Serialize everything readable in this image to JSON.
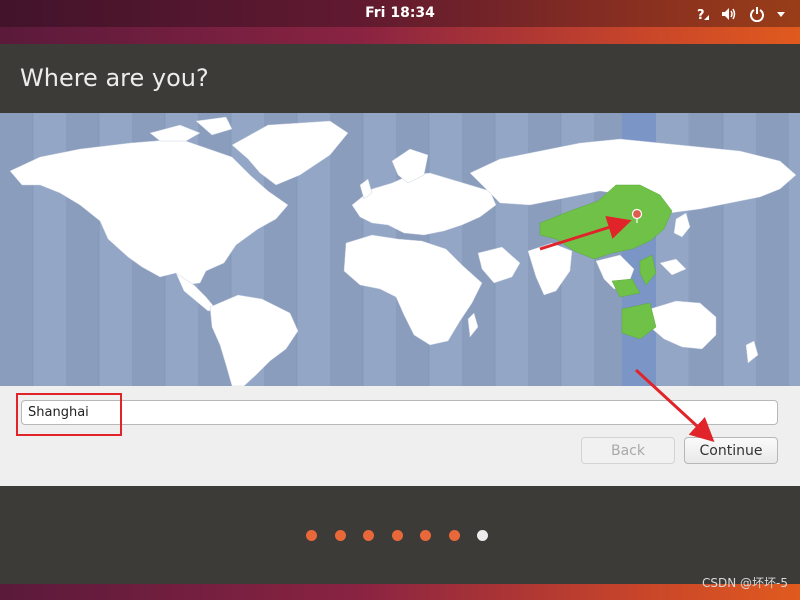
{
  "topbar": {
    "clock": "Fri 18:34",
    "icons": [
      "help-icon",
      "volume-icon",
      "power-icon",
      "chevron-down-icon"
    ]
  },
  "installer": {
    "title": "Where are you?",
    "location": {
      "value": "Shanghai",
      "selected_timezone": "Asia/Shanghai",
      "highlight_color": "#6fc247"
    },
    "buttons": {
      "back": "Back",
      "continue": "Continue"
    },
    "progress": {
      "total_steps": 7,
      "current_step": 7
    }
  },
  "colors": {
    "accent": "#e9683a",
    "annotation": "#e0242a",
    "map_ocean": "#93a6c6",
    "map_land": "#ffffff"
  },
  "watermark": "CSDN @坏坏-5"
}
